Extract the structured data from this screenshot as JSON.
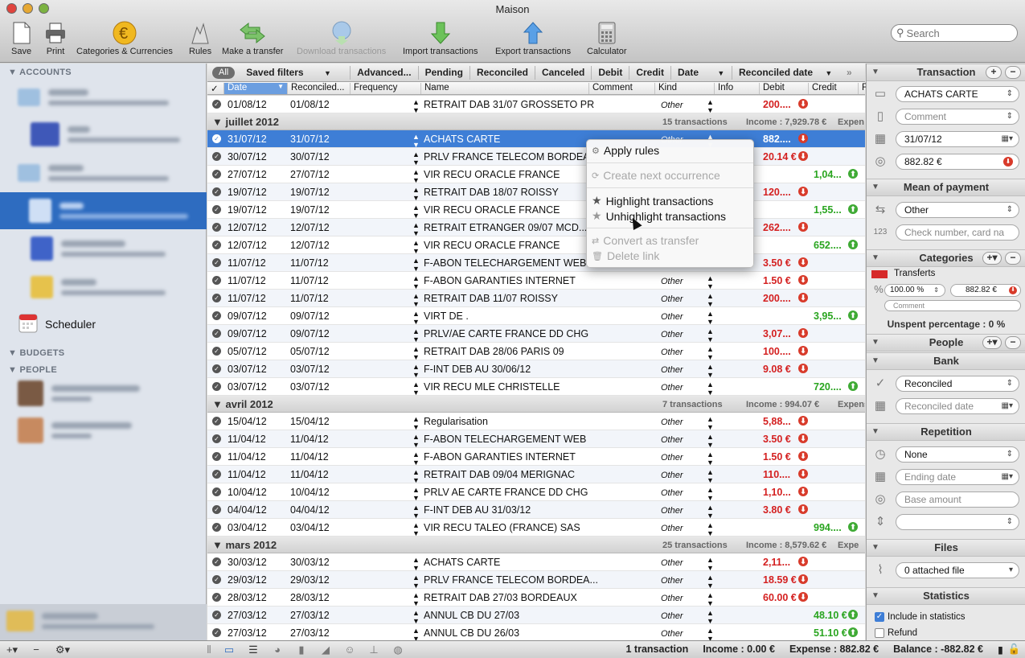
{
  "window": {
    "title": "Maison"
  },
  "toolbar": {
    "save": "Save",
    "print": "Print",
    "categories": "Categories & Currencies",
    "rules": "Rules",
    "transfer": "Make a transfer",
    "download": "Download transactions",
    "import": "Import transactions",
    "export": "Export transactions",
    "calculator": "Calculator",
    "search_placeholder": "Search"
  },
  "sidebar": {
    "accounts_header": "ACCOUNTS",
    "budgets_header": "BUDGETS",
    "people_header": "PEOPLE",
    "scheduler": "Scheduler"
  },
  "filters": {
    "all": "All",
    "saved": "Saved filters",
    "advanced": "Advanced...",
    "pending": "Pending",
    "reconciled": "Reconciled",
    "canceled": "Canceled",
    "debit": "Debit",
    "credit": "Credit",
    "date": "Date",
    "reconciled_date": "Reconciled date",
    "more": "»"
  },
  "columns": {
    "check": "✓",
    "date": "Date",
    "reconciled": "Reconciled...",
    "frequency": "Frequency",
    "name": "Name",
    "comment": "Comment",
    "kind": "Kind",
    "info": "Info",
    "debit": "Debit",
    "credit": "Credit",
    "extra": "F"
  },
  "rows": [
    {
      "type": "row",
      "date": "01/08/12",
      "rec": "01/08/12",
      "name": "RETRAIT DAB 31/07 GROSSETO PR",
      "kind": "Other",
      "debit": "200....",
      "credit": ""
    },
    {
      "type": "group",
      "name": "juillet 2012",
      "count": "15 transactions",
      "income": "Income : 7,929.78 €",
      "expense": "Expen"
    },
    {
      "type": "row",
      "sel": true,
      "date": "31/07/12",
      "rec": "31/07/12",
      "name": "ACHATS CARTE",
      "kind": "Other",
      "debit": "882....",
      "credit": ""
    },
    {
      "type": "row",
      "date": "30/07/12",
      "rec": "30/07/12",
      "name": "PRLV FRANCE TELECOM BORDEA...",
      "kind": "",
      "debit": "20.14 €",
      "credit": ""
    },
    {
      "type": "row",
      "date": "27/07/12",
      "rec": "27/07/12",
      "name": "VIR RECU ORACLE FRANCE",
      "kind": "",
      "debit": "",
      "credit": "1,04..."
    },
    {
      "type": "row",
      "date": "19/07/12",
      "rec": "19/07/12",
      "name": "RETRAIT DAB 18/07 ROISSY",
      "kind": "",
      "debit": "120....",
      "credit": ""
    },
    {
      "type": "row",
      "date": "19/07/12",
      "rec": "19/07/12",
      "name": "VIR RECU ORACLE FRANCE",
      "kind": "",
      "debit": "",
      "credit": "1,55..."
    },
    {
      "type": "row",
      "date": "12/07/12",
      "rec": "12/07/12",
      "name": "RETRAIT ETRANGER 09/07 MCD...",
      "kind": "",
      "debit": "262....",
      "credit": ""
    },
    {
      "type": "row",
      "date": "12/07/12",
      "rec": "12/07/12",
      "name": "VIR RECU ORACLE FRANCE",
      "kind": "",
      "debit": "",
      "credit": "652...."
    },
    {
      "type": "row",
      "date": "11/07/12",
      "rec": "11/07/12",
      "name": "F-ABON TELECHARGEMENT WEB",
      "kind": "",
      "debit": "3.50 €",
      "credit": ""
    },
    {
      "type": "row",
      "date": "11/07/12",
      "rec": "11/07/12",
      "name": "F-ABON GARANTIES INTERNET",
      "kind": "Other",
      "debit": "1.50 €",
      "credit": ""
    },
    {
      "type": "row",
      "date": "11/07/12",
      "rec": "11/07/12",
      "name": "RETRAIT DAB 11/07 ROISSY",
      "kind": "Other",
      "debit": "200....",
      "credit": ""
    },
    {
      "type": "row",
      "date": "09/07/12",
      "rec": "09/07/12",
      "name": "VIRT DE .",
      "kind": "Other",
      "debit": "",
      "credit": "3,95..."
    },
    {
      "type": "row",
      "date": "09/07/12",
      "rec": "09/07/12",
      "name": "PRLV/AE CARTE FRANCE DD CHG",
      "kind": "Other",
      "debit": "3,07...",
      "credit": ""
    },
    {
      "type": "row",
      "date": "05/07/12",
      "rec": "05/07/12",
      "name": "RETRAIT DAB 28/06 PARIS 09",
      "kind": "Other",
      "debit": "100....",
      "credit": ""
    },
    {
      "type": "row",
      "date": "03/07/12",
      "rec": "03/07/12",
      "name": "F-INT DEB AU 30/06/12",
      "kind": "Other",
      "debit": "9.08 €",
      "credit": ""
    },
    {
      "type": "row",
      "date": "03/07/12",
      "rec": "03/07/12",
      "name": "VIR RECU MLE CHRISTELLE",
      "kind": "Other",
      "debit": "",
      "credit": "720...."
    },
    {
      "type": "group",
      "name": "avril 2012",
      "count": "7 transactions",
      "income": "Income : 994.07 €",
      "expense": "Expens"
    },
    {
      "type": "row",
      "date": "15/04/12",
      "rec": "15/04/12",
      "name": "Regularisation",
      "kind": "Other",
      "debit": "5,88...",
      "credit": ""
    },
    {
      "type": "row",
      "date": "11/04/12",
      "rec": "11/04/12",
      "name": "F-ABON TELECHARGEMENT WEB",
      "kind": "Other",
      "debit": "3.50 €",
      "credit": ""
    },
    {
      "type": "row",
      "date": "11/04/12",
      "rec": "11/04/12",
      "name": "F-ABON GARANTIES INTERNET",
      "kind": "Other",
      "debit": "1.50 €",
      "credit": ""
    },
    {
      "type": "row",
      "date": "11/04/12",
      "rec": "11/04/12",
      "name": "RETRAIT DAB 09/04 MERIGNAC",
      "kind": "Other",
      "debit": "110....",
      "credit": ""
    },
    {
      "type": "row",
      "date": "10/04/12",
      "rec": "10/04/12",
      "name": "PRLV AE CARTE FRANCE DD CHG",
      "kind": "Other",
      "debit": "1,10...",
      "credit": ""
    },
    {
      "type": "row",
      "date": "04/04/12",
      "rec": "04/04/12",
      "name": "F-INT DEB AU 31/03/12",
      "kind": "Other",
      "debit": "3.80 €",
      "credit": ""
    },
    {
      "type": "row",
      "date": "03/04/12",
      "rec": "03/04/12",
      "name": "VIR RECU TALEO (FRANCE) SAS",
      "kind": "Other",
      "debit": "",
      "credit": "994...."
    },
    {
      "type": "group",
      "name": "mars 2012",
      "count": "25 transactions",
      "income": "Income : 8,579.62 €",
      "expense": "Expe"
    },
    {
      "type": "row",
      "date": "30/03/12",
      "rec": "30/03/12",
      "name": "ACHATS CARTE",
      "kind": "Other",
      "debit": "2,11...",
      "credit": ""
    },
    {
      "type": "row",
      "date": "29/03/12",
      "rec": "29/03/12",
      "name": "PRLV FRANCE TELECOM BORDEA...",
      "kind": "Other",
      "debit": "18.59 €",
      "credit": ""
    },
    {
      "type": "row",
      "date": "28/03/12",
      "rec": "28/03/12",
      "name": "RETRAIT DAB 27/03 BORDEAUX",
      "kind": "Other",
      "debit": "60.00 €",
      "credit": ""
    },
    {
      "type": "row",
      "date": "27/03/12",
      "rec": "27/03/12",
      "name": "ANNUL CB DU 27/03",
      "kind": "Other",
      "debit": "",
      "credit": "48.10 €"
    },
    {
      "type": "row",
      "date": "27/03/12",
      "rec": "27/03/12",
      "name": "ANNUL CB DU 26/03",
      "kind": "Other",
      "debit": "",
      "credit": "51.10 €"
    }
  ],
  "context_menu": {
    "apply_rules": "Apply rules",
    "create_next": "Create next occurrence",
    "highlight": "Highlight transactions",
    "unhighlight": "Unhighlight transactions",
    "convert": "Convert as transfer",
    "delete_link": "Delete link"
  },
  "inspector": {
    "transaction_header": "Transaction",
    "name_value": "ACHATS CARTE",
    "comment_placeholder": "Comment",
    "date_value": "31/07/12",
    "amount_value": "882.82 €",
    "payment_header": "Mean of payment",
    "payment_value": "Other",
    "check_placeholder": "Check number, card na",
    "categories_header": "Categories",
    "category_name": "Transferts",
    "category_percent": "100.00 %",
    "category_amount": "882.82 €",
    "category_comment": "Comment",
    "unspent": "Unspent percentage : 0 %",
    "people_header": "People",
    "bank_header": "Bank",
    "bank_status": "Reconciled",
    "reconciled_date_placeholder": "Reconciled date",
    "repetition_header": "Repetition",
    "repetition_value": "None",
    "ending_date_placeholder": "Ending date",
    "base_amount_placeholder": "Base amount",
    "files_header": "Files",
    "files_value": "0 attached file",
    "statistics_header": "Statistics",
    "include_stats": "Include in statistics",
    "refund": "Refund"
  },
  "status": {
    "count": "1 transaction",
    "income": "Income : 0.00 €",
    "expense": "Expense : 882.82 €",
    "balance": "Balance : -882.82 €"
  },
  "colors": {
    "selection": "#3e7ed6",
    "debit": "#d42020",
    "credit": "#2aa520",
    "sidebar_sel": "#2e6cc0"
  }
}
